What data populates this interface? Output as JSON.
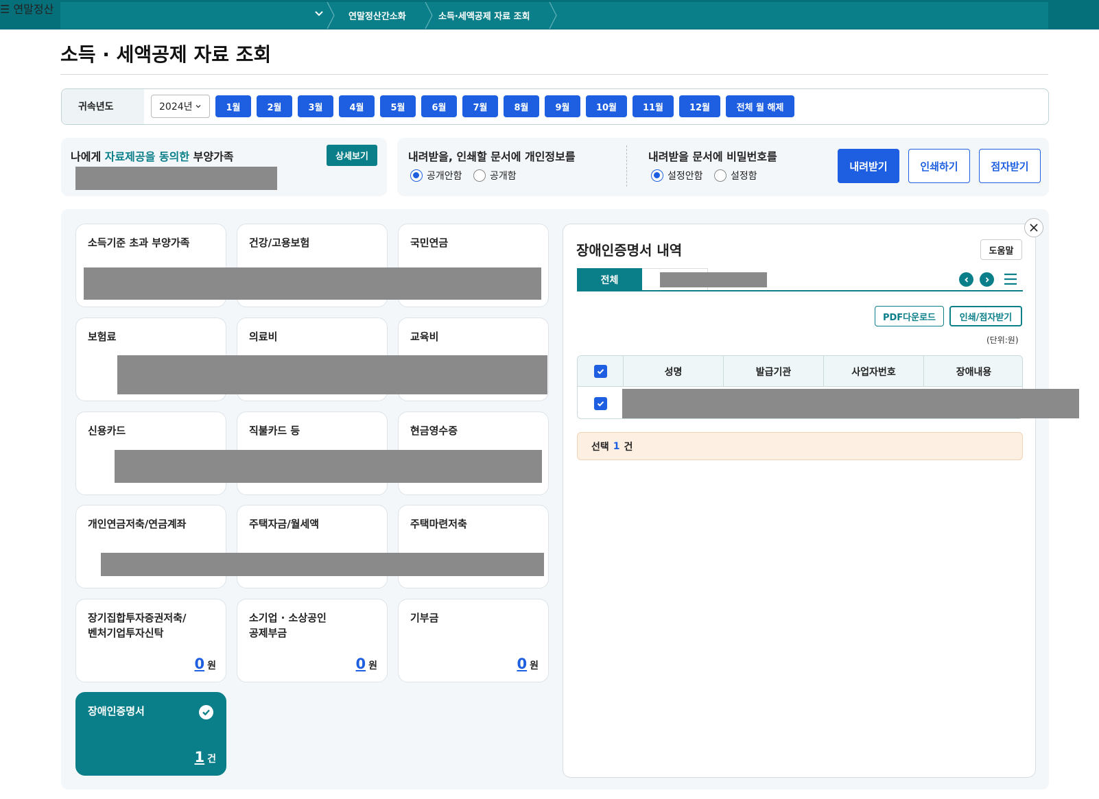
{
  "topbar": {
    "menu_label": "연말정산",
    "menu_icon": "hamburger-icon",
    "breadcrumb": [
      "연말정산간소화",
      "소득·세액공제 자료 조회"
    ]
  },
  "page": {
    "title": "소득 · 세액공제 자료 조회"
  },
  "filter": {
    "label": "귀속년도",
    "year": "2024년",
    "months": [
      "1월",
      "2월",
      "3월",
      "4월",
      "5월",
      "6월",
      "7월",
      "8월",
      "9월",
      "10월",
      "11월",
      "12월"
    ],
    "clear_all": "전체 월 해제"
  },
  "consent": {
    "title_pre": "나에게 ",
    "title_hl": "자료제공을 동의한",
    "title_post": " 부양가족",
    "detail_button": "상세보기"
  },
  "privacy": {
    "title": "내려받을, 인쇄할 문서에 개인정보를",
    "options": [
      "공개안함",
      "공개함"
    ],
    "selected": "공개안함"
  },
  "password": {
    "title": "내려받을 문서에 비밀번호를",
    "options": [
      "설정안함",
      "설정함"
    ],
    "selected": "설정안함"
  },
  "actions": {
    "download": "내려받기",
    "print": "인쇄하기",
    "braille": "점자받기"
  },
  "cards": [
    {
      "title": "소득기준 초과 부양가족"
    },
    {
      "title": "건강/고용보험"
    },
    {
      "title": "국민연금"
    },
    {
      "title": "보험료"
    },
    {
      "title": "의료비"
    },
    {
      "title": "교육비"
    },
    {
      "title": "신용카드"
    },
    {
      "title": "직불카드 등"
    },
    {
      "title": "현금영수증"
    },
    {
      "title": "개인연금저축/연금계좌"
    },
    {
      "title": "주택자금/월세액"
    },
    {
      "title": "주택마련저축"
    },
    {
      "title": "장기집합투자증권저축/\n벤처기업투자신탁",
      "value": "0",
      "unit": "원"
    },
    {
      "title": "소기업 · 소상공인\n공제부금",
      "value": "0",
      "unit": "원"
    },
    {
      "title": "기부금",
      "value": "0",
      "unit": "원"
    },
    {
      "title": "장애인증명서",
      "value": "1",
      "unit": "건",
      "selected": true
    }
  ],
  "detail": {
    "title": "장애인증명서 내역",
    "help": "도움말",
    "tab_all": "전체",
    "pdf_download": "PDF다운로드",
    "print_braille": "인쇄/점자받기",
    "unit_note": "(단위:원)",
    "columns": [
      "성명",
      "발급기관",
      "사업자번호",
      "장애내용"
    ],
    "selection_pre": "선택",
    "selection_count": "1",
    "selection_post": "건"
  },
  "colors": {
    "teal": "#0a7f89",
    "blue": "#1d5fe0",
    "redaction": "#8a8a8a"
  }
}
